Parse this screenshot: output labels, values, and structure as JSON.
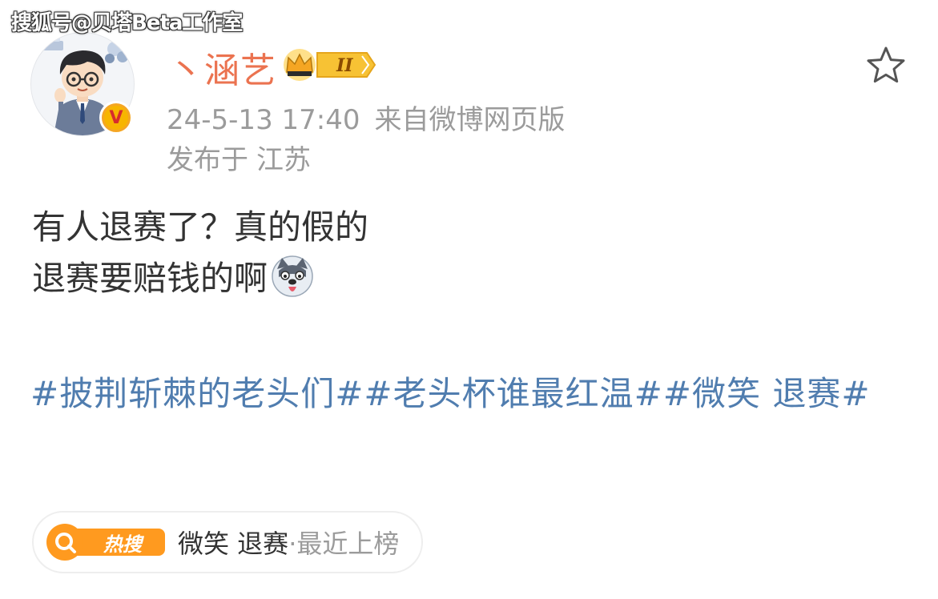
{
  "watermark": "搜狐号@贝塔Beta工作室",
  "user": {
    "name": "丶涵艺",
    "vip_level": "II",
    "verified_mark": "V"
  },
  "post": {
    "time": "24-5-13 17:40",
    "source": "来自微博网页版",
    "published_label": "发布于",
    "location": "江苏",
    "line1": "有人退赛了？真的假的",
    "line2": "退赛要赔钱的啊",
    "emoji": "doge-emoji"
  },
  "topics": [
    "#披荆斩棘的老头们#",
    "#老头杯谁最红温#",
    "#微笑 退赛#"
  ],
  "hot_search": {
    "badge": "热搜",
    "keyword": "微笑 退赛",
    "status": "·最近上榜"
  },
  "icons": {
    "favorite": "star-outline-icon",
    "hot_logo": "search-q-icon"
  },
  "colors": {
    "username": "#eb7350",
    "topic": "#507daf",
    "meta": "#9b9b9b",
    "hot": "#ff9a1f"
  }
}
